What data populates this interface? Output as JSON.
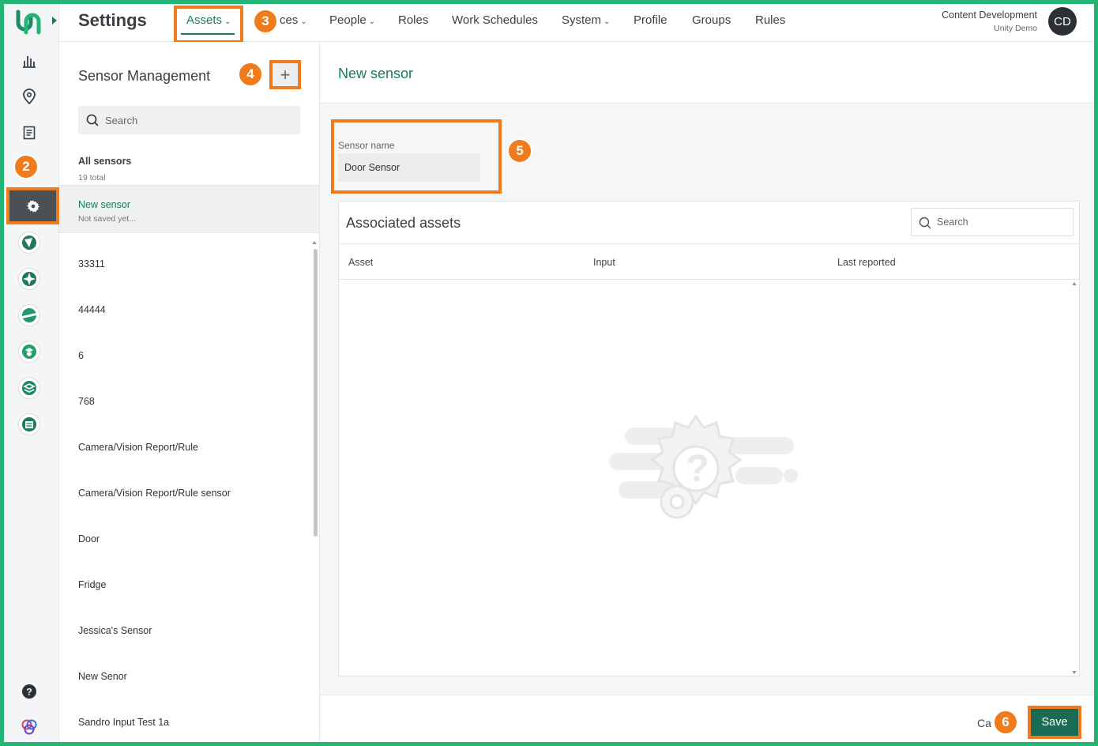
{
  "header": {
    "page_title": "Settings",
    "nav": [
      {
        "label": "Assets",
        "has_caret": true,
        "active": true
      },
      {
        "label": "ces",
        "has_caret": true
      },
      {
        "label": "People",
        "has_caret": true
      },
      {
        "label": "Roles"
      },
      {
        "label": "Work Schedules"
      },
      {
        "label": "System",
        "has_caret": true
      },
      {
        "label": "Profile"
      },
      {
        "label": "Groups"
      },
      {
        "label": "Rules"
      }
    ],
    "user_name": "Content Development",
    "org_name": "Unity Demo",
    "avatar_initials": "CD"
  },
  "badges": {
    "b2": "2",
    "b3": "3",
    "b4": "4",
    "b5": "5",
    "b6": "6"
  },
  "sidebar": {
    "icons": [
      "analytics-icon",
      "location-pin-icon",
      "report-icon",
      "settings-gear-icon"
    ],
    "apps": [
      "app-1-icon",
      "app-2-icon",
      "app-3-icon",
      "app-4-icon",
      "app-5-icon",
      "app-6-icon"
    ],
    "bottom": [
      "help-icon",
      "partner-logo-icon"
    ]
  },
  "sensor_list": {
    "title": "Sensor Management",
    "add_label": "+",
    "search_placeholder": "Search",
    "all_label": "All sensors",
    "total": "19 total",
    "selected": {
      "name": "New sensor",
      "status": "Not saved yet..."
    },
    "items": [
      "33311",
      "44444",
      "6",
      "768",
      "Camera/Vision Report/Rule",
      "Camera/Vision Report/Rule sensor",
      "Door",
      "Fridge",
      "Jessica's Sensor",
      "New Senor",
      "Sandro Input Test 1a"
    ]
  },
  "detail": {
    "title": "New sensor",
    "sensor_name_label": "Sensor name",
    "sensor_name_value": "Door Sensor",
    "assoc_title": "Associated assets",
    "assoc_search_placeholder": "Search",
    "columns": [
      "Asset",
      "Input",
      "Last reported"
    ],
    "cancel_label": "Ca",
    "save_label": "Save"
  },
  "colors": {
    "accent": "#1a7a5e",
    "highlight": "#f07b1d",
    "frame": "#22b573"
  }
}
